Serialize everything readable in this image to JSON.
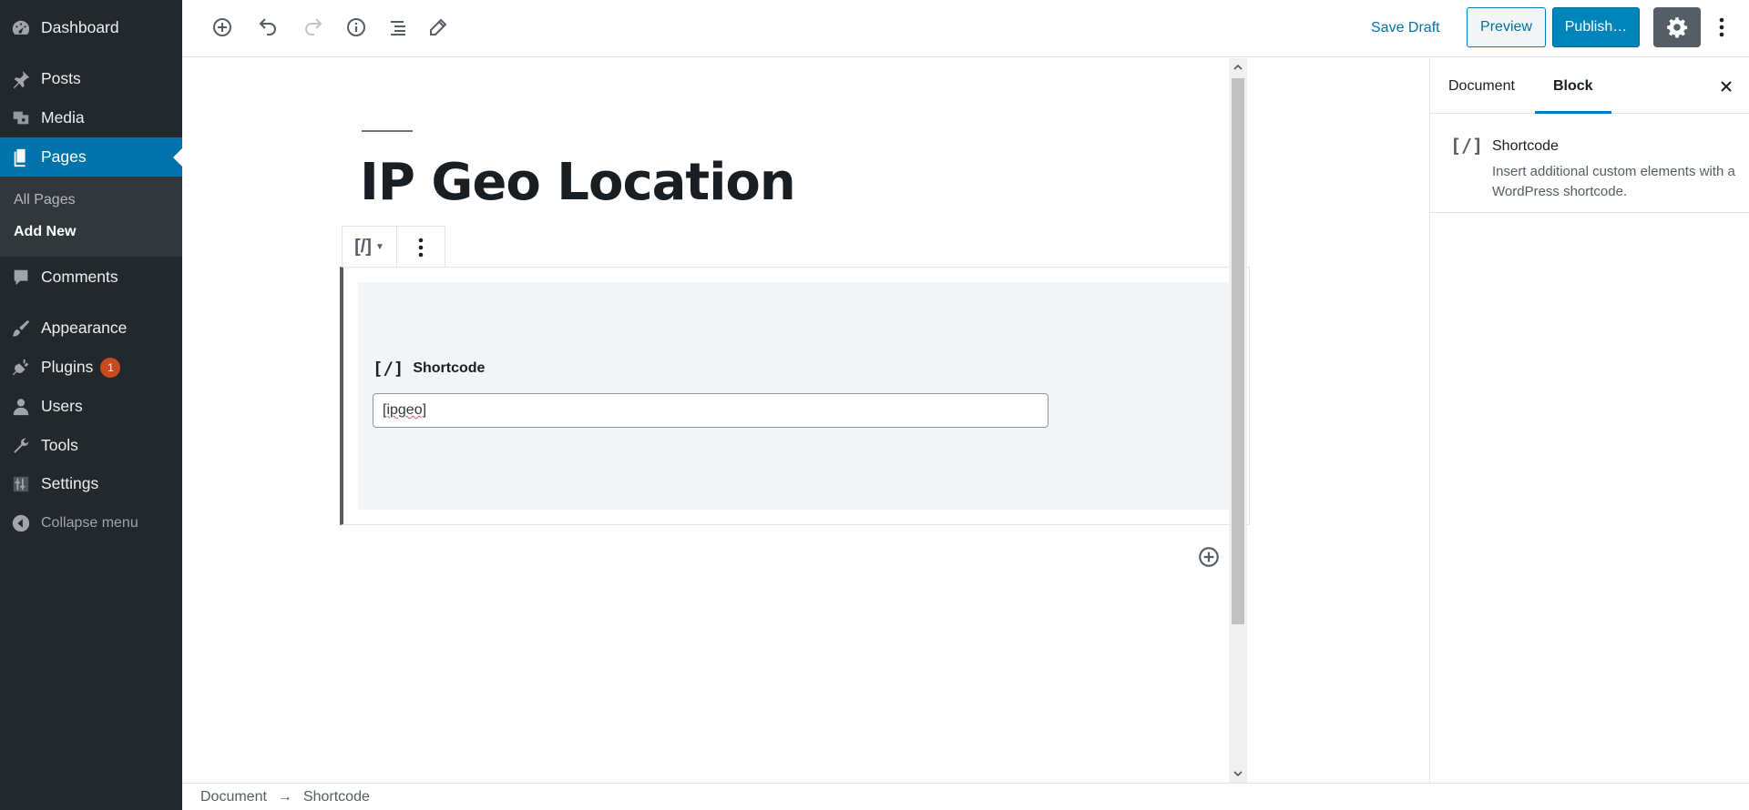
{
  "admin_menu": {
    "items": [
      {
        "label": "Dashboard",
        "icon": "dashboard-icon"
      },
      {
        "label": "Posts",
        "icon": "pin-icon"
      },
      {
        "label": "Media",
        "icon": "media-icon"
      },
      {
        "label": "Pages",
        "icon": "pages-icon"
      },
      {
        "label": "Comments",
        "icon": "comment-icon"
      },
      {
        "label": "Appearance",
        "icon": "brush-icon"
      },
      {
        "label": "Plugins",
        "icon": "plug-icon",
        "badge": "1"
      },
      {
        "label": "Users",
        "icon": "user-icon"
      },
      {
        "label": "Tools",
        "icon": "wrench-icon"
      },
      {
        "label": "Settings",
        "icon": "sliders-icon"
      },
      {
        "label": "Collapse menu",
        "icon": "collapse-icon"
      }
    ],
    "submenu": [
      {
        "label": "All Pages"
      },
      {
        "label": "Add New"
      }
    ],
    "active": "Pages",
    "accent": "#0073aa"
  },
  "toolbar": {
    "save_draft": "Save Draft",
    "preview": "Preview",
    "publish": "Publish…"
  },
  "editor": {
    "title": "IP Geo Location",
    "block": {
      "switcher_icon": "[/]",
      "label": "Shortcode",
      "value": "[ipgeo]"
    }
  },
  "settings_panel": {
    "tabs": [
      "Document",
      "Block"
    ],
    "active_tab": "Block",
    "block_card": {
      "icon": "[/]",
      "title": "Shortcode",
      "description": "Insert additional custom elements with a WordPress shortcode."
    }
  },
  "footer": {
    "breadcrumb": [
      "Document",
      "Shortcode"
    ],
    "separator": "→"
  }
}
